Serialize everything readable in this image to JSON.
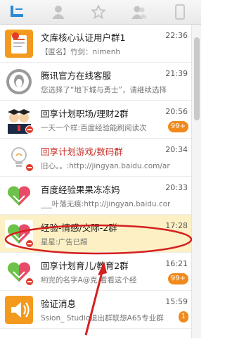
{
  "tabs": [
    {
      "name": "recent-chat-tab-icon",
      "active": true
    },
    {
      "name": "contacts-tab-icon",
      "active": false
    },
    {
      "name": "favorites-tab-icon",
      "active": false
    },
    {
      "name": "groups-tab-icon",
      "active": false
    },
    {
      "name": "phone-tab-icon",
      "active": false
    }
  ],
  "conversations": [
    {
      "title": "文库核心认证用户群1",
      "time": "22:36",
      "preview": "【匿名】竹剑：nimenh",
      "badge": "",
      "icon": "doc-avatar-icon",
      "muted": false,
      "title_red": false
    },
    {
      "title": "腾讯官方在线客服",
      "time": "21:39",
      "preview": "您选择了“地下城与勇士”，请继续选择",
      "badge": "",
      "icon": "penguin-avatar-icon",
      "muted": false,
      "title_red": false
    },
    {
      "title": "回享计划职场/理财2群",
      "time": "20:56",
      "preview": "一天一个样:百度经验能刷阅读次",
      "badge": "99+",
      "icon": "graduates-avatar-icon",
      "muted": true,
      "title_red": false
    },
    {
      "title": "回享计划游戏/数码群",
      "time": "20:34",
      "preview": "旧心。。:http://jingyan.baidu.com/article",
      "badge": "",
      "icon": "lightbulb-avatar-icon",
      "muted": true,
      "title_red": true
    },
    {
      "title": "百度经验果果冻冻妈",
      "time": "20:33",
      "preview": "___叶落无痕:http://jingyan.baidu.com/art",
      "badge": "",
      "icon": "heart-avatar-icon",
      "muted": false,
      "title_red": false
    },
    {
      "title": "经验-情感/交际-2群",
      "time": "17:28",
      "preview": "星星:广告已踢",
      "badge": "",
      "icon": "heart-avatar-icon",
      "muted": true,
      "title_red": false,
      "selected": true
    },
    {
      "title": "回享计划育儿/教育2群",
      "time": "16:21",
      "preview": "哟完的名字A@克 看看这个经",
      "badge": "99+",
      "icon": "heart-avatar-icon",
      "muted": true,
      "title_red": false
    },
    {
      "title": "验证消息",
      "time": "15:59",
      "preview": "Ssion_ Studio退出群联想A65专业群",
      "badge": "1",
      "icon": "speaker-avatar-icon",
      "muted": false,
      "title_red": false
    }
  ],
  "colors": {
    "annotation": "#d42020",
    "selected_row": "#fcf0c4",
    "badge": "#f08a1c"
  }
}
